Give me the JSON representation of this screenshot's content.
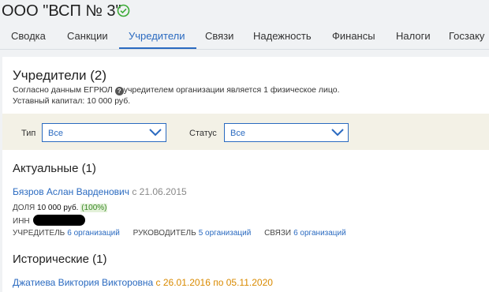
{
  "company": {
    "title": "ООО \"ВСП № 3\"",
    "status_icon": "verified-check-icon",
    "status_color": "#3aaa35"
  },
  "tabs": [
    {
      "label": "Сводка"
    },
    {
      "label": "Санкции"
    },
    {
      "label": "Учредители",
      "active": true
    },
    {
      "label": "Связи"
    },
    {
      "label": "Надежность"
    },
    {
      "label": "Финансы"
    },
    {
      "label": "Налоги"
    },
    {
      "label": "Госзаку"
    }
  ],
  "founders": {
    "title": "Учредители (2)",
    "note_prefix": "Согласно данным ЕГРЮЛ",
    "note_suffix": "учредителем организации является 1 физическое лицо.",
    "capital": "Уставный капитал: 10 000 руб."
  },
  "filters": {
    "type_label": "Тип",
    "type_value": "Все",
    "status_label": "Статус",
    "status_value": "Все"
  },
  "current": {
    "title": "Актуальные (1)",
    "person": {
      "name": "Бязров Аслан Варденович",
      "since": "с 21.06.2015"
    },
    "share_label": "ДОЛЯ",
    "share_value": "10 000 руб.",
    "share_percent": "(100%)",
    "inn_label": "ИНН",
    "roles": [
      {
        "label": "УЧРЕДИТЕЛЬ",
        "link": "6 организаций"
      },
      {
        "label": "РУКОВОДИТЕЛЬ",
        "link": "5 организаций"
      },
      {
        "label": "СВЯЗИ",
        "link": "6 организаций"
      }
    ]
  },
  "historical": {
    "title": "Исторические (1)",
    "person": {
      "name": "Джатиева Виктория Викторовна",
      "period": "с 26.01.2016 по 05.11.2020"
    }
  },
  "colors": {
    "accent": "#2a6ac0",
    "filter_bg": "#f3f1e6",
    "percent_green": "#3c8a2a",
    "history_date": "#d98a00"
  }
}
